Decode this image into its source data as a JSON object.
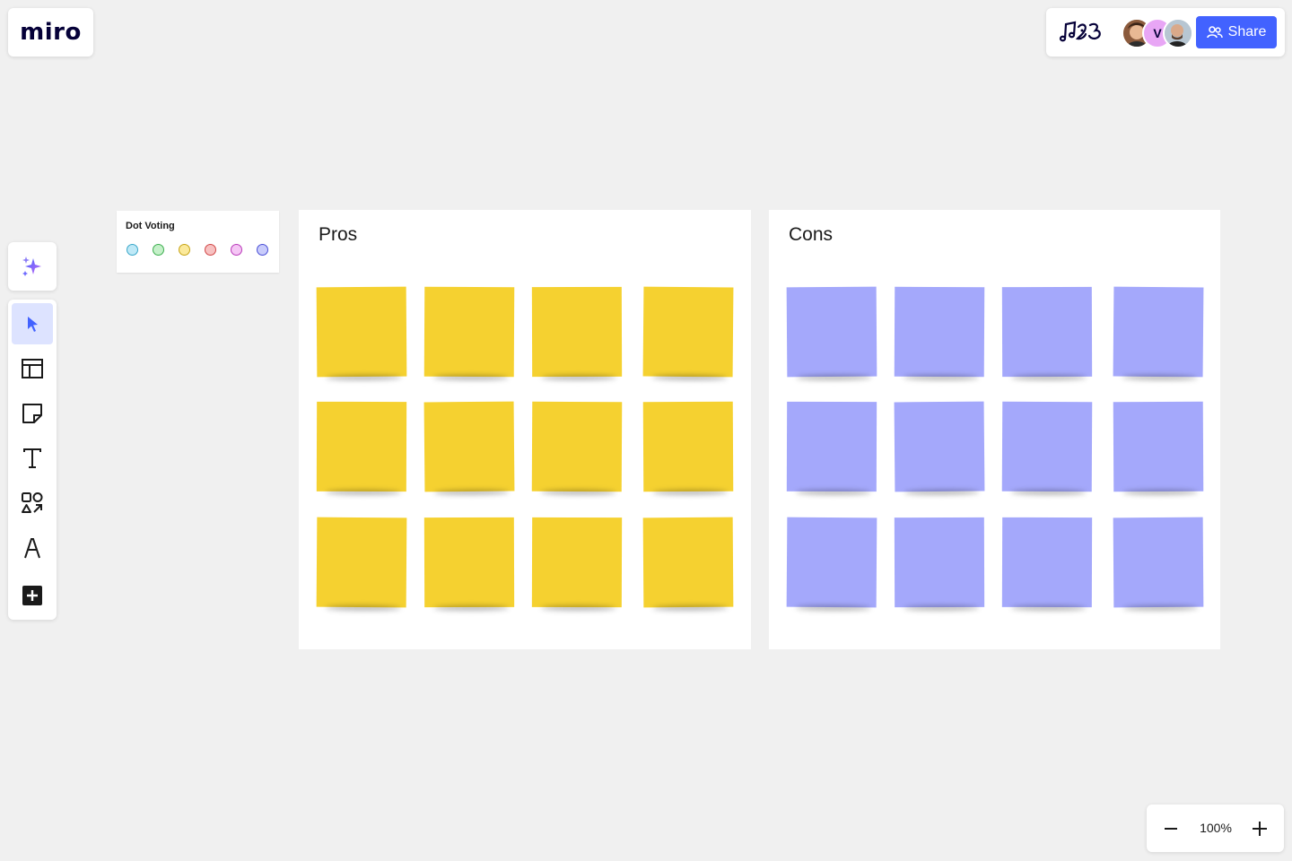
{
  "app": {
    "logo_text": "miro"
  },
  "header": {
    "board_logo_icon": "board-signature-icon",
    "collaborators": [
      {
        "name": "avatar-user-1",
        "initial": ""
      },
      {
        "name": "avatar-user-v",
        "initial": "V"
      },
      {
        "name": "avatar-user-3",
        "initial": ""
      }
    ],
    "share_label": "Share",
    "share_color": "#4262ff"
  },
  "toolbar": {
    "ai_icon": "sparkle-icon",
    "tools": [
      {
        "name": "select-tool",
        "icon": "cursor-icon",
        "active": true
      },
      {
        "name": "templates-tool",
        "icon": "layout-icon",
        "active": false
      },
      {
        "name": "sticky-note-tool",
        "icon": "sticky-note-icon",
        "active": false
      },
      {
        "name": "text-tool",
        "icon": "text-icon",
        "active": false
      },
      {
        "name": "shapes-tool",
        "icon": "shapes-icon",
        "active": false
      },
      {
        "name": "pen-tool",
        "icon": "pen-icon",
        "active": false
      },
      {
        "name": "more-tools",
        "icon": "plus-square-icon",
        "active": false
      }
    ]
  },
  "dot_voting": {
    "title": "Dot Voting",
    "dots": [
      {
        "fill": "#bfe9f7",
        "stroke": "#3aa7c9"
      },
      {
        "fill": "#c5f0c9",
        "stroke": "#3dae4f"
      },
      {
        "fill": "#fbe99b",
        "stroke": "#c7a415"
      },
      {
        "fill": "#f7c1c1",
        "stroke": "#d14747"
      },
      {
        "fill": "#f5c6f5",
        "stroke": "#b93ab9"
      },
      {
        "fill": "#c9ccfb",
        "stroke": "#4a4fd6"
      }
    ]
  },
  "frames": [
    {
      "title": "Pros",
      "sticky_color": "#f5d130",
      "sticky_count": 12
    },
    {
      "title": "Cons",
      "sticky_color": "#a4a8fb",
      "sticky_count": 12
    }
  ],
  "zoom": {
    "level": "100%"
  }
}
